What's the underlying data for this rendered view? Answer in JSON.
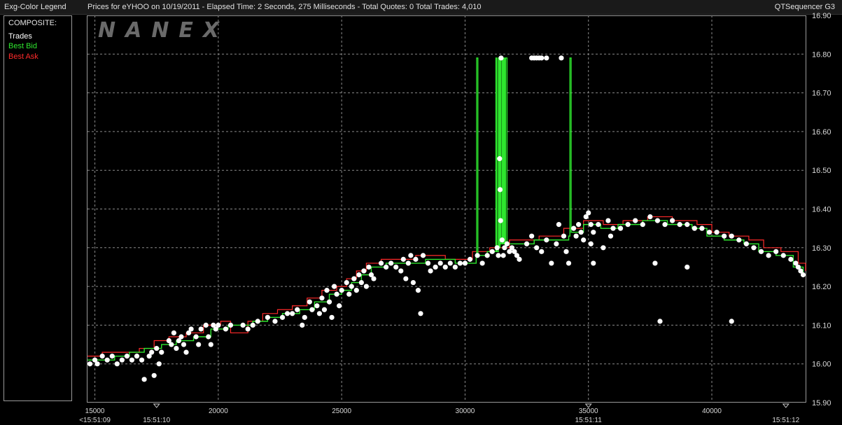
{
  "header": {
    "legend_title": "Exg-Color Legend",
    "chart_title": "Prices for  eYHOO  on  10/19/2011  -  Elapsed Time: 2 Seconds, 275 Milliseconds  -  Total Quotes: 0  Total Trades: 4,010",
    "app_name": "QTSequencer G3"
  },
  "legend": {
    "heading": "COMPOSITE:",
    "items": [
      {
        "label": "Trades",
        "color": "#ffffff"
      },
      {
        "label": "Best Bid",
        "color": "#2ee62e"
      },
      {
        "label": "Best Ask",
        "color": "#ff2a2a"
      }
    ]
  },
  "watermark": "NANEX",
  "chart_data": {
    "type": "scatter",
    "title": "",
    "xlabel": "",
    "ylabel": "",
    "xlim": [
      14700,
      43800
    ],
    "ylim": [
      15.9,
      16.9
    ],
    "grid": true,
    "y_ticks": [
      "15.90",
      "16.00",
      "16.10",
      "16.20",
      "16.30",
      "16.40",
      "16.50",
      "16.60",
      "16.70",
      "16.80",
      "16.90"
    ],
    "x_ticks": [
      {
        "x": 15000,
        "label": "15000"
      },
      {
        "x": 20000,
        "label": "20000"
      },
      {
        "x": 25000,
        "label": "25000"
      },
      {
        "x": 30000,
        "label": "30000"
      },
      {
        "x": 35000,
        "label": "35000"
      },
      {
        "x": 40000,
        "label": "40000"
      }
    ],
    "time_ticks": [
      {
        "x": 15000,
        "label": "<15:51:09"
      },
      {
        "x": 17500,
        "label": "15:51:10"
      },
      {
        "x": 35000,
        "label": "15:51:11"
      },
      {
        "x": 43000,
        "label": "15:51:12"
      }
    ],
    "time_markers": [
      17500,
      35000,
      43000
    ],
    "series": [
      {
        "name": "Best Bid",
        "color": "#2ee62e",
        "step": [
          [
            14700,
            16.01
          ],
          [
            15800,
            16.02
          ],
          [
            16400,
            16.03
          ],
          [
            17000,
            16.04
          ],
          [
            17700,
            16.05
          ],
          [
            18300,
            16.06
          ],
          [
            19000,
            16.07
          ],
          [
            19700,
            16.09
          ],
          [
            20400,
            16.1
          ],
          [
            21400,
            16.11
          ],
          [
            22000,
            16.12
          ],
          [
            22600,
            16.13
          ],
          [
            23300,
            16.14
          ],
          [
            23900,
            16.16
          ],
          [
            24500,
            16.18
          ],
          [
            25000,
            16.19
          ],
          [
            25400,
            16.21
          ],
          [
            25800,
            16.23
          ],
          [
            26200,
            16.25
          ],
          [
            26800,
            16.26
          ],
          [
            28400,
            16.27
          ],
          [
            29600,
            16.26
          ],
          [
            30450,
            16.28
          ],
          [
            30470,
            16.79
          ],
          [
            30520,
            16.28
          ],
          [
            30900,
            16.29
          ],
          [
            31250,
            16.79
          ],
          [
            31290,
            16.29
          ],
          [
            31350,
            16.79
          ],
          [
            31380,
            16.3
          ],
          [
            31420,
            16.79
          ],
          [
            31450,
            16.31
          ],
          [
            31500,
            16.79
          ],
          [
            31530,
            16.31
          ],
          [
            31560,
            16.79
          ],
          [
            31600,
            16.31
          ],
          [
            31640,
            16.79
          ],
          [
            31700,
            16.31
          ],
          [
            32800,
            16.32
          ],
          [
            34200,
            16.33
          ],
          [
            34250,
            16.79
          ],
          [
            34300,
            16.34
          ],
          [
            34800,
            16.36
          ],
          [
            35500,
            16.35
          ],
          [
            36200,
            16.36
          ],
          [
            37200,
            16.37
          ],
          [
            38200,
            16.36
          ],
          [
            39200,
            16.35
          ],
          [
            39800,
            16.33
          ],
          [
            40500,
            16.32
          ],
          [
            41300,
            16.31
          ],
          [
            41900,
            16.29
          ],
          [
            42600,
            16.28
          ],
          [
            43300,
            16.25
          ],
          [
            43700,
            16.23
          ],
          [
            43800,
            16.23
          ]
        ]
      },
      {
        "name": "Best Ask",
        "color": "#ff2a2a",
        "step": [
          [
            14700,
            16.02
          ],
          [
            15300,
            16.03
          ],
          [
            16000,
            16.03
          ],
          [
            16800,
            16.04
          ],
          [
            17400,
            16.06
          ],
          [
            18000,
            16.07
          ],
          [
            18700,
            16.08
          ],
          [
            19400,
            16.1
          ],
          [
            20100,
            16.11
          ],
          [
            20500,
            16.08
          ],
          [
            21200,
            16.11
          ],
          [
            21800,
            16.13
          ],
          [
            22400,
            16.14
          ],
          [
            23000,
            16.15
          ],
          [
            23600,
            16.17
          ],
          [
            24200,
            16.19
          ],
          [
            24800,
            16.2
          ],
          [
            25200,
            16.22
          ],
          [
            25600,
            16.24
          ],
          [
            26000,
            16.26
          ],
          [
            26600,
            16.27
          ],
          [
            28000,
            16.28
          ],
          [
            29200,
            16.27
          ],
          [
            30300,
            16.29
          ],
          [
            31000,
            16.3
          ],
          [
            31800,
            16.32
          ],
          [
            33000,
            16.33
          ],
          [
            34000,
            16.35
          ],
          [
            34800,
            16.37
          ],
          [
            35600,
            16.36
          ],
          [
            36400,
            16.37
          ],
          [
            37400,
            16.38
          ],
          [
            38400,
            16.37
          ],
          [
            39400,
            16.36
          ],
          [
            40000,
            16.34
          ],
          [
            40700,
            16.33
          ],
          [
            41500,
            16.32
          ],
          [
            42100,
            16.3
          ],
          [
            42800,
            16.29
          ],
          [
            43500,
            16.26
          ],
          [
            43800,
            16.24
          ]
        ]
      },
      {
        "name": "Trades",
        "color": "#ffffff",
        "points": [
          [
            14800,
            16.0
          ],
          [
            15000,
            16.01
          ],
          [
            15100,
            16.0
          ],
          [
            15300,
            16.02
          ],
          [
            15500,
            16.01
          ],
          [
            15700,
            16.02
          ],
          [
            15900,
            16.0
          ],
          [
            16100,
            16.01
          ],
          [
            16300,
            16.02
          ],
          [
            16500,
            16.01
          ],
          [
            16700,
            16.02
          ],
          [
            16900,
            16.01
          ],
          [
            17000,
            15.96
          ],
          [
            17200,
            16.02
          ],
          [
            17300,
            16.03
          ],
          [
            17400,
            15.97
          ],
          [
            17500,
            16.04
          ],
          [
            17600,
            16.0
          ],
          [
            17700,
            16.03
          ],
          [
            18000,
            16.06
          ],
          [
            18100,
            16.05
          ],
          [
            18200,
            16.08
          ],
          [
            18300,
            16.04
          ],
          [
            18400,
            16.06
          ],
          [
            18500,
            16.07
          ],
          [
            18600,
            16.05
          ],
          [
            18700,
            16.03
          ],
          [
            18800,
            16.08
          ],
          [
            18900,
            16.09
          ],
          [
            19100,
            16.07
          ],
          [
            19200,
            16.05
          ],
          [
            19300,
            16.09
          ],
          [
            19500,
            16.1
          ],
          [
            19600,
            16.07
          ],
          [
            19700,
            16.05
          ],
          [
            19800,
            16.1
          ],
          [
            19900,
            16.09
          ],
          [
            20000,
            16.1
          ],
          [
            20300,
            16.09
          ],
          [
            20500,
            16.1
          ],
          [
            21000,
            16.1
          ],
          [
            21200,
            16.09
          ],
          [
            21400,
            16.1
          ],
          [
            21600,
            16.11
          ],
          [
            22000,
            16.12
          ],
          [
            22300,
            16.11
          ],
          [
            22600,
            16.12
          ],
          [
            22800,
            16.13
          ],
          [
            23000,
            16.13
          ],
          [
            23200,
            16.14
          ],
          [
            23400,
            16.1
          ],
          [
            23500,
            16.12
          ],
          [
            23700,
            16.16
          ],
          [
            23800,
            16.14
          ],
          [
            24000,
            16.15
          ],
          [
            24100,
            16.13
          ],
          [
            24200,
            16.17
          ],
          [
            24300,
            16.14
          ],
          [
            24400,
            16.19
          ],
          [
            24500,
            16.16
          ],
          [
            24600,
            16.12
          ],
          [
            24700,
            16.2
          ],
          [
            24800,
            16.18
          ],
          [
            24900,
            16.15
          ],
          [
            25000,
            16.19
          ],
          [
            25200,
            16.21
          ],
          [
            25300,
            16.18
          ],
          [
            25400,
            16.2
          ],
          [
            25500,
            16.22
          ],
          [
            25600,
            16.19
          ],
          [
            25700,
            16.23
          ],
          [
            25800,
            16.21
          ],
          [
            25900,
            16.24
          ],
          [
            26000,
            16.2
          ],
          [
            26100,
            16.25
          ],
          [
            26200,
            16.23
          ],
          [
            26300,
            16.22
          ],
          [
            26600,
            16.26
          ],
          [
            26800,
            16.25
          ],
          [
            27000,
            16.26
          ],
          [
            27200,
            16.25
          ],
          [
            27400,
            16.24
          ],
          [
            27500,
            16.27
          ],
          [
            27600,
            16.22
          ],
          [
            27700,
            16.26
          ],
          [
            27800,
            16.28
          ],
          [
            27900,
            16.21
          ],
          [
            28000,
            16.27
          ],
          [
            28100,
            16.19
          ],
          [
            28200,
            16.13
          ],
          [
            28300,
            16.28
          ],
          [
            28500,
            16.26
          ],
          [
            28600,
            16.24
          ],
          [
            28800,
            16.25
          ],
          [
            29000,
            16.26
          ],
          [
            29200,
            16.25
          ],
          [
            29400,
            16.26
          ],
          [
            29600,
            16.25
          ],
          [
            29800,
            16.26
          ],
          [
            30000,
            16.26
          ],
          [
            30200,
            16.27
          ],
          [
            30500,
            16.28
          ],
          [
            30700,
            16.26
          ],
          [
            30900,
            16.28
          ],
          [
            31100,
            16.29
          ],
          [
            31300,
            16.3
          ],
          [
            31350,
            16.28
          ],
          [
            31400,
            16.53
          ],
          [
            31420,
            16.45
          ],
          [
            31440,
            16.37
          ],
          [
            31460,
            16.79
          ],
          [
            31500,
            16.32
          ],
          [
            31550,
            16.28
          ],
          [
            31600,
            16.3
          ],
          [
            31700,
            16.31
          ],
          [
            31800,
            16.29
          ],
          [
            31900,
            16.3
          ],
          [
            32000,
            16.29
          ],
          [
            32100,
            16.28
          ],
          [
            32200,
            16.27
          ],
          [
            32700,
            16.79
          ],
          [
            32800,
            16.79
          ],
          [
            32900,
            16.79
          ],
          [
            33000,
            16.79
          ],
          [
            33100,
            16.79
          ],
          [
            33300,
            16.79
          ],
          [
            33900,
            16.79
          ],
          [
            32500,
            16.31
          ],
          [
            32700,
            16.33
          ],
          [
            32900,
            16.3
          ],
          [
            33100,
            16.29
          ],
          [
            33300,
            16.32
          ],
          [
            33500,
            16.26
          ],
          [
            33700,
            16.31
          ],
          [
            33800,
            16.36
          ],
          [
            34000,
            16.33
          ],
          [
            34100,
            16.29
          ],
          [
            34200,
            16.26
          ],
          [
            34400,
            16.35
          ],
          [
            34500,
            16.33
          ],
          [
            34600,
            16.36
          ],
          [
            34700,
            16.34
          ],
          [
            34800,
            16.32
          ],
          [
            34900,
            16.38
          ],
          [
            35000,
            16.39
          ],
          [
            35100,
            16.36
          ],
          [
            35200,
            16.34
          ],
          [
            35400,
            16.36
          ],
          [
            35600,
            16.3
          ],
          [
            35800,
            16.37
          ],
          [
            35900,
            16.33
          ],
          [
            36000,
            16.35
          ],
          [
            35100,
            16.31
          ],
          [
            35200,
            16.26
          ],
          [
            36300,
            16.35
          ],
          [
            36600,
            16.36
          ],
          [
            36900,
            16.37
          ],
          [
            37200,
            16.36
          ],
          [
            37500,
            16.38
          ],
          [
            37800,
            16.37
          ],
          [
            38100,
            16.36
          ],
          [
            38400,
            16.37
          ],
          [
            38700,
            16.36
          ],
          [
            39000,
            16.36
          ],
          [
            39300,
            16.35
          ],
          [
            39600,
            16.35
          ],
          [
            39900,
            16.34
          ],
          [
            40200,
            16.34
          ],
          [
            40500,
            16.33
          ],
          [
            40800,
            16.33
          ],
          [
            41100,
            16.32
          ],
          [
            41400,
            16.31
          ],
          [
            41700,
            16.3
          ],
          [
            42000,
            16.29
          ],
          [
            42300,
            16.28
          ],
          [
            42600,
            16.29
          ],
          [
            42900,
            16.28
          ],
          [
            43200,
            16.27
          ],
          [
            43400,
            16.26
          ],
          [
            43500,
            16.25
          ],
          [
            43600,
            16.24
          ],
          [
            43700,
            16.23
          ],
          [
            37700,
            16.26
          ],
          [
            39000,
            16.25
          ],
          [
            37900,
            16.11
          ],
          [
            40800,
            16.11
          ]
        ]
      }
    ]
  }
}
